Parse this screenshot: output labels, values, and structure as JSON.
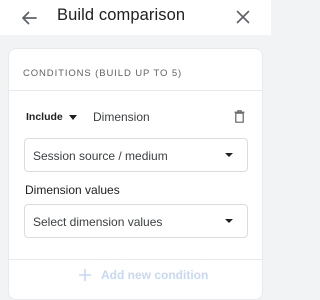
{
  "header": {
    "title": "Build comparison",
    "back_icon": "arrow-back-icon",
    "close_icon": "close-icon"
  },
  "conditions": {
    "section_title": "CONDITIONS (BUILD UP TO 5)",
    "include_value": "Include",
    "dimension_label": "Dimension",
    "delete_icon": "trash-icon",
    "dimension_select_value": "Session source / medium",
    "values_label": "Dimension values",
    "values_select_placeholder": "Select dimension values",
    "add_condition_label": "Add new condition",
    "add_condition_enabled": false
  },
  "colors": {
    "accent_disabled": "#c6d8f5",
    "text_primary": "#202124",
    "text_secondary": "#5f6368",
    "background": "#f1f3f4"
  }
}
